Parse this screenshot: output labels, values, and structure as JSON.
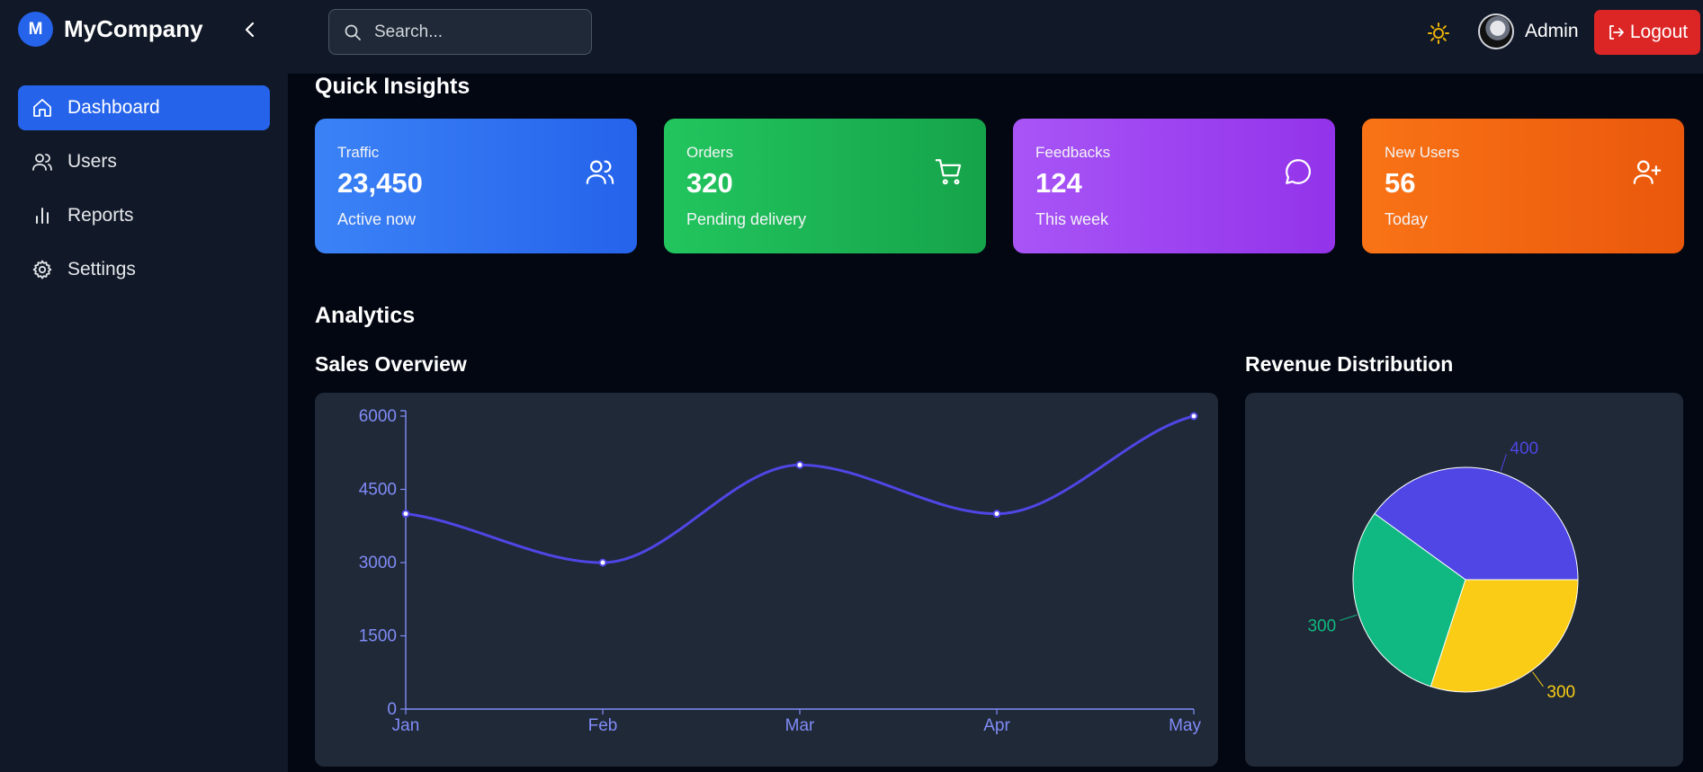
{
  "topbar": {
    "logo_letter": "M",
    "brand_name": "MyCompany",
    "collapse_icon": "chevron-left-icon",
    "search_placeholder": "Search...",
    "theme_icon": "sun-icon",
    "user_name": "Admin",
    "logout_label": "Logout",
    "colors": {
      "accent": "#2563eb",
      "logout": "#dc2626",
      "sun": "#eab308"
    }
  },
  "sidebar": {
    "items": [
      {
        "label": "Dashboard",
        "icon": "home-icon",
        "active": true
      },
      {
        "label": "Users",
        "icon": "users-icon",
        "active": false
      },
      {
        "label": "Reports",
        "icon": "bar-chart-icon",
        "active": false
      },
      {
        "label": "Settings",
        "icon": "gear-icon",
        "active": false
      }
    ]
  },
  "main": {
    "insights_title": "Quick Insights",
    "analytics_title": "Analytics",
    "cards": [
      {
        "title": "Traffic",
        "value": "23,450",
        "sub": "Active now",
        "icon": "users-icon",
        "colors": [
          "#3b82f6",
          "#2563eb"
        ]
      },
      {
        "title": "Orders",
        "value": "320",
        "sub": "Pending delivery",
        "icon": "cart-icon",
        "colors": [
          "#22c55e",
          "#16a34a"
        ]
      },
      {
        "title": "Feedbacks",
        "value": "124",
        "sub": "This week",
        "icon": "message-icon",
        "colors": [
          "#a855f7",
          "#9333ea"
        ]
      },
      {
        "title": "New Users",
        "value": "56",
        "sub": "Today",
        "icon": "user-plus-icon",
        "colors": [
          "#f97316",
          "#ea580c"
        ]
      }
    ],
    "sales_title": "Sales Overview",
    "revenue_title": "Revenue Distribution"
  },
  "chart_data": [
    {
      "type": "line",
      "title": "Sales Overview",
      "categories": [
        "Jan",
        "Feb",
        "Mar",
        "Apr",
        "May"
      ],
      "series": [
        {
          "values": [
            4000,
            3000,
            5000,
            4000,
            6000
          ],
          "color": "#4f46e5"
        }
      ],
      "yticks": [
        0,
        1500,
        3000,
        4500,
        6000
      ],
      "ylim": [
        0,
        6000
      ],
      "grid": false,
      "axis_color": "#818cf8",
      "smooth": true
    },
    {
      "type": "pie",
      "title": "Revenue Distribution",
      "slices": [
        {
          "value": 400,
          "color": "#4f46e5"
        },
        {
          "value": 300,
          "color": "#10b981"
        },
        {
          "value": 300,
          "color": "#facc15"
        }
      ],
      "labels_outside": true
    }
  ]
}
